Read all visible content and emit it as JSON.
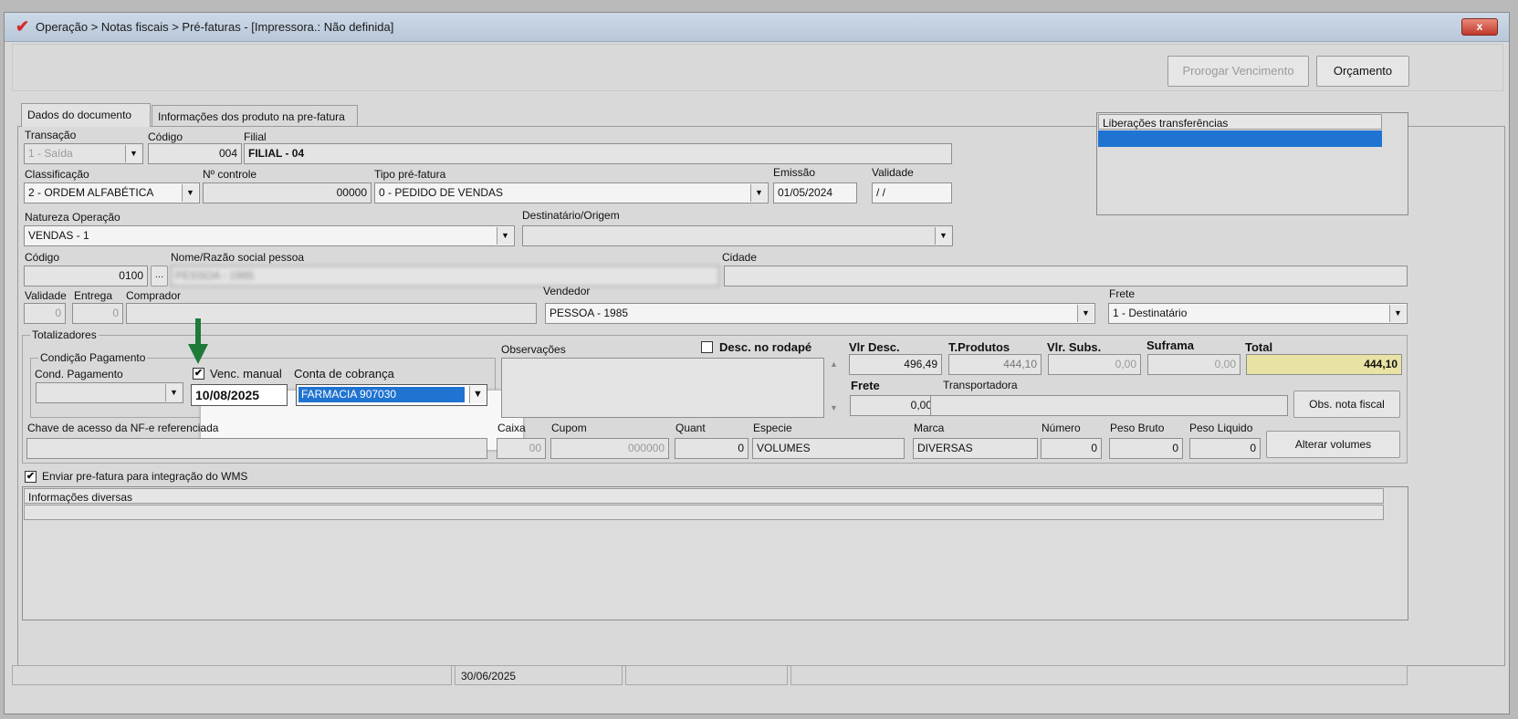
{
  "window": {
    "title": "Operação > Notas fiscais > Pré-faturas - [Impressora.: Não definida]",
    "close_label": "x"
  },
  "toolbar": {
    "prorrogar_label": "Prorogar Vencimento",
    "orcamento_label": "Orçamento"
  },
  "tabs": [
    {
      "label": "Dados do documento"
    },
    {
      "label": "Informações dos produto na pre-fatura"
    }
  ],
  "header": {
    "transacao_label": "Transação",
    "transacao_value": "1 - Saída",
    "codigo_label": "Código",
    "codigo_value": "004",
    "filial_label": "Filial",
    "filial_value": "FILIAL - 04",
    "classificacao_label": "Classificação",
    "classificacao_value": "2 - ORDEM ALFABÉTICA",
    "controle_label": "Nº controle",
    "controle_value": "00000",
    "tipo_label": "Tipo pré-fatura",
    "tipo_value": "0 - PEDIDO DE VENDAS",
    "emissao_label": "Emissão",
    "emissao_value": "01/05/2024",
    "validade_label": "Validade",
    "validade_value": " / /",
    "natureza_label": "Natureza  Operação",
    "natureza_value": "VENDAS - 1",
    "destinatario_label": "Destinatário/Origem",
    "destinatario_value": "",
    "cod_pessoa_label": "Código",
    "cod_pessoa_value": "0100",
    "nome_label": "Nome/Razão social pessoa",
    "nome_value": "PESSOA - 1985",
    "cidade_label": "Cidade",
    "cidade_value": "",
    "validade2_label": "Validade",
    "validade2_value": "0",
    "entrega_label": "Entrega",
    "entrega_value": "0",
    "comprador_label": "Comprador",
    "comprador_value": "",
    "vendedor_label": "Vendedor",
    "vendedor_value": "PESSOA - 1985",
    "frete_label": "Frete",
    "frete_value": "1 - Destinatário"
  },
  "liberacoes": {
    "header": "Liberações transferências"
  },
  "totalizadores": {
    "title": "Totalizadores",
    "condicao_title": "Condição Pagamento",
    "cond_pag_label": "Cond. Pagamento",
    "cond_pag_value": "",
    "venc_manual_label": "Venc. manual",
    "venc_manual_checked": "✔",
    "venc_date": "10/08/2025",
    "conta_label": "Conta de cobrança",
    "conta_value": "FARMACIA 907030",
    "observacoes_label": "Observações",
    "desc_rodape_label": "Desc. no rodapé",
    "vlr_desc_label": "Vlr Desc.",
    "vlr_desc_value": "496,49",
    "t_produtos_label": "T.Produtos",
    "t_produtos_value": "444,10",
    "vlr_subs_label": "Vlr. Subs.",
    "vlr_subs_value": "0,00",
    "suframa_label": "Suframa",
    "suframa_value": "0,00",
    "total_label": "Total",
    "total_value": "444,10",
    "frete_label": "Frete",
    "frete_value": "0,00",
    "transportadora_label": "Transportadora",
    "transportadora_value": "",
    "obs_nota_label": "Obs. nota fiscal",
    "chave_label": "Chave de acesso da NF-e referenciada",
    "chave_value": "",
    "caixa_label": "Caixa",
    "caixa_value": "00",
    "cupom_label": "Cupom",
    "cupom_value": "000000",
    "quant_label": "Quant",
    "quant_value": "0",
    "especie_label": "Especie",
    "especie_value": "VOLUMES",
    "marca_label": "Marca",
    "marca_value": "DIVERSAS",
    "numero_label": "Número",
    "numero_value": "0",
    "peso_bruto_label": "Peso Bruto",
    "peso_bruto_value": "0",
    "peso_liquido_label": "Peso Liquido",
    "peso_liquido_value": "0",
    "alterar_volumes_label": "Alterar volumes"
  },
  "wms": {
    "label": "Enviar pre-fatura para integração do WMS",
    "checked": "✔"
  },
  "info_diversas": {
    "header": "Informações diversas"
  },
  "statusbar": {
    "date": "30/06/2025"
  },
  "colors": {
    "total_bg": "#e8e2a4",
    "selection_blue": "#1f73d1",
    "arrow_green": "#1f7a3a"
  }
}
